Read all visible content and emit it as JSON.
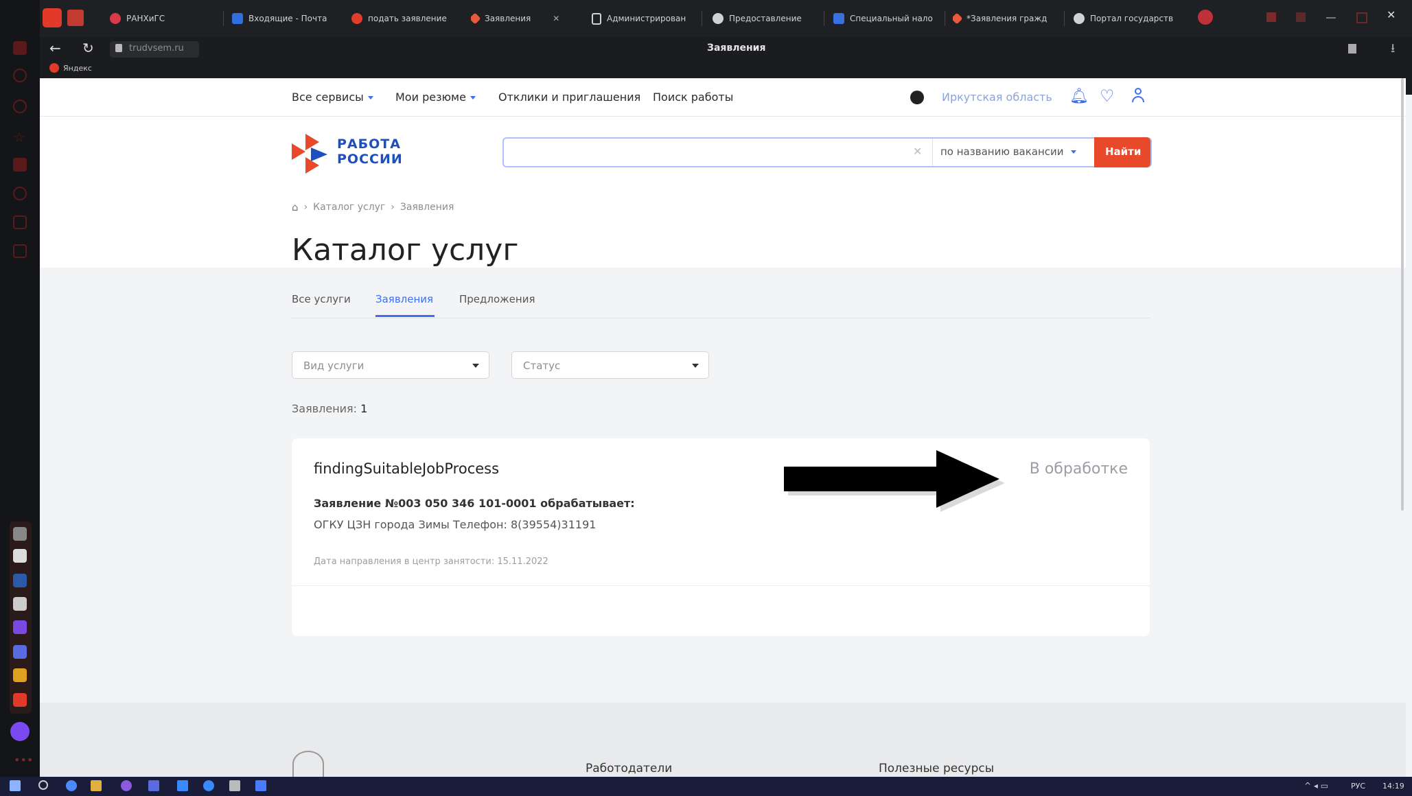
{
  "browser": {
    "tabs": [
      {
        "label": "РАНХиГС",
        "color": "#d93a4a"
      },
      {
        "label": "Входящие - Почта",
        "color": "#2f6fe0"
      },
      {
        "label": "подать заявление",
        "color": "#e03d2d"
      },
      {
        "label": "Заявления",
        "color": "#e85a3a"
      },
      {
        "label": "Администрирован",
        "color": "#cfd2d6"
      },
      {
        "label": "Предоставление",
        "color": "#cfd2d6"
      },
      {
        "label": "Специальный нало",
        "color": "#3a6fe0"
      },
      {
        "label": "*Заявления гражд",
        "color": "#e85a3a"
      },
      {
        "label": "Портал государств",
        "color": "#cfd2d6"
      }
    ],
    "address": "trudvsem.ru",
    "page_title": "Заявления",
    "bookmark": "Яндекс"
  },
  "nav": {
    "all_services": "Все сервисы",
    "my_resumes": "Мои резюме",
    "responses": "Отклики и приглашения",
    "job_search": "Поиск работы",
    "region": "Иркутская область"
  },
  "brand": {
    "line1": "РАБОТА",
    "line2": "РОССИИ"
  },
  "search": {
    "placeholder": "",
    "mode": "по названию вакансии",
    "button": "Найти"
  },
  "breadcrumb": {
    "item1": "Каталог услуг",
    "item2": "Заявления"
  },
  "heading": "Каталог услуг",
  "tabs": {
    "all": "Все услуги",
    "applications": "Заявления",
    "offers": "Предложения"
  },
  "filters": {
    "service_type": "Вид услуги",
    "status": "Статус"
  },
  "count_label": "Заявления:",
  "count_value": "1",
  "application": {
    "title": "findingSuitableJobProcess",
    "status": "В обработке",
    "handler_line": "Заявление №003 050 346 101-0001 обрабатывает:",
    "org_line": "ОГКУ ЦЗН города Зимы Телефон: 8(39554)31191",
    "date_line": "Дата направления в центр занятости: 15.11.2022"
  },
  "footer": {
    "col1": "Работодатели",
    "col2": "Полезные ресурсы"
  },
  "taskbar": {
    "lang": "РУС",
    "time": "14:19"
  },
  "colors": {
    "accent": "#3d6ff5",
    "brand_red": "#e8492b",
    "status_gray": "#9a9ea4"
  }
}
